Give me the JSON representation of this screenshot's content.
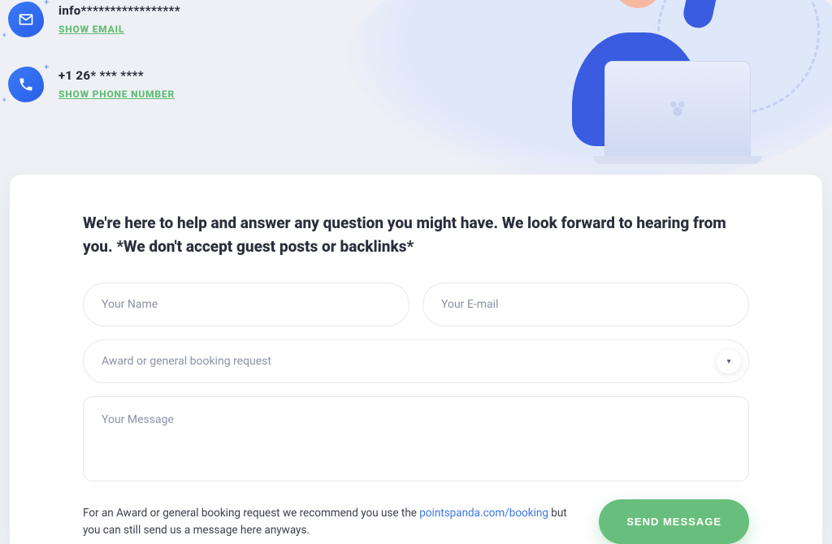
{
  "contact": {
    "email": {
      "masked": "info*****************",
      "show_label": "SHOW EMAIL"
    },
    "phone": {
      "masked": "+1 26* *** ****",
      "show_label": "SHOW PHONE NUMBER"
    }
  },
  "form": {
    "heading": "We're here to help and answer any question you might have. We look forward to hearing from you. *We don't accept guest posts or backlinks*",
    "name_placeholder": "Your Name",
    "email_placeholder": "Your E-mail",
    "subject_selected": "Award or general booking request",
    "message_placeholder": "Your Message",
    "note_prefix": "For an Award or general booking request we recommend you use the ",
    "note_link_text": "pointspanda.com/booking",
    "note_suffix": " but you can still send us a message here anyways.",
    "submit_label": "SEND MESSAGE"
  }
}
